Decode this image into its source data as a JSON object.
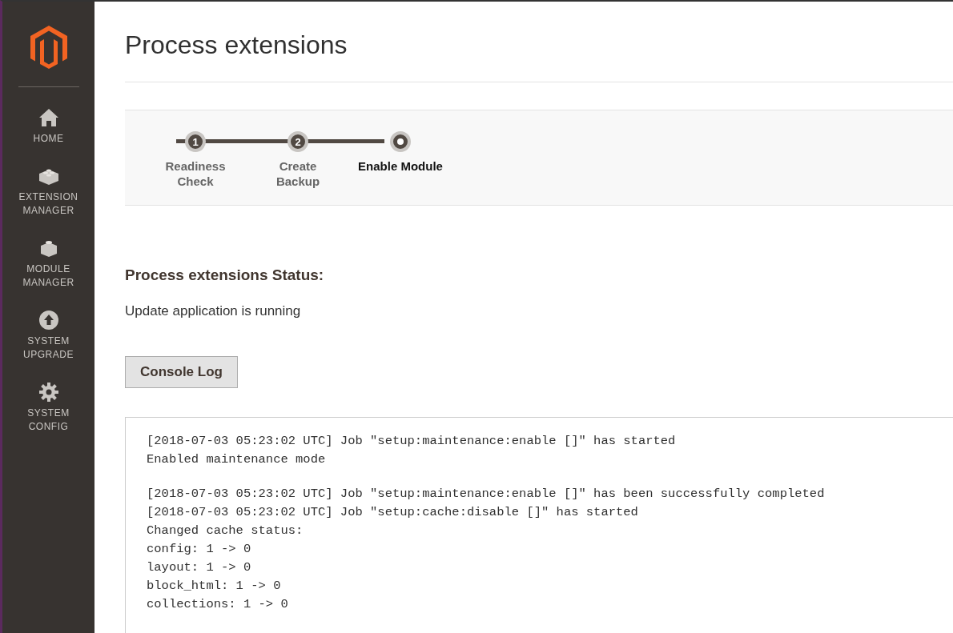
{
  "sidebar": {
    "items": [
      {
        "label": "HOME",
        "kind": "home"
      },
      {
        "label": "EXTENSION MANAGER",
        "kind": "extension"
      },
      {
        "label": "MODULE MANAGER",
        "kind": "module"
      },
      {
        "label": "SYSTEM UPGRADE",
        "kind": "upgrade"
      },
      {
        "label": "SYSTEM CONFIG",
        "kind": "config"
      }
    ]
  },
  "title": "Process extensions",
  "steps": [
    {
      "number": "1",
      "label": "Readiness Check",
      "selected": false
    },
    {
      "number": "2",
      "label": "Create Backup",
      "selected": false
    },
    {
      "label": "Enable Module",
      "selected": true
    }
  ],
  "status": {
    "heading": "Process extensions Status:",
    "message": "Update application is running"
  },
  "console_button": "Console Log",
  "log_blocks": [
    [
      "[2018-07-03 05:23:02 UTC] Job \"setup:maintenance:enable []\" has started",
      "Enabled maintenance mode"
    ],
    [
      "[2018-07-03 05:23:02 UTC] Job \"setup:maintenance:enable []\" has been successfully completed",
      "[2018-07-03 05:23:02 UTC] Job \"setup:cache:disable []\" has started",
      "Changed cache status:",
      "config: 1 -> 0",
      "layout: 1 -> 0",
      "block_html: 1 -> 0",
      "collections: 1 -> 0"
    ]
  ]
}
